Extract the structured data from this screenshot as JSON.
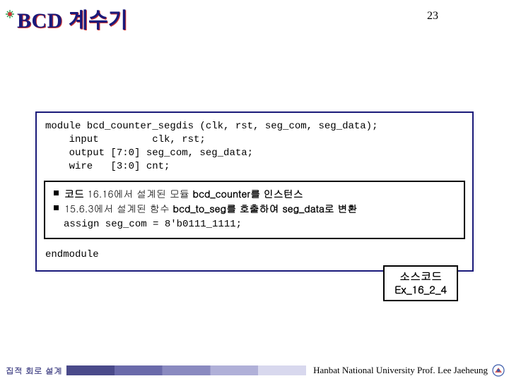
{
  "header": {
    "title": "BCD 계수기",
    "page_number": "23"
  },
  "code": {
    "decl": "module bcd_counter_segdis (clk, rst, seg_com, seg_data);\n    input         clk, rst;\n    output [7:0] seg_com, seg_data;\n    wire   [3:0] cnt;",
    "note1_prefix": "코드 ",
    "note1_mid": "16.16에서 설계된 모듈 ",
    "note1_code": "bcd_counter",
    "note1_suffix": "를 인스턴스",
    "note2_prefix": "",
    "note2_mid": "15.6.3에서 설계된 함수 ",
    "note2_code": "bcd_to_seg",
    "note2_mid2": "를 호출하여 ",
    "note2_code2": "seg_data",
    "note2_suffix": "로 변환",
    "assign": "assign seg_com = 8'b0111_1111;",
    "end": "endmodule"
  },
  "src_label": {
    "line1": "소스코드",
    "line2": "Ex_16_2_4"
  },
  "footer": {
    "left": "집적 회로 설계",
    "right": "Hanbat National University Prof. Lee Jaeheung"
  }
}
